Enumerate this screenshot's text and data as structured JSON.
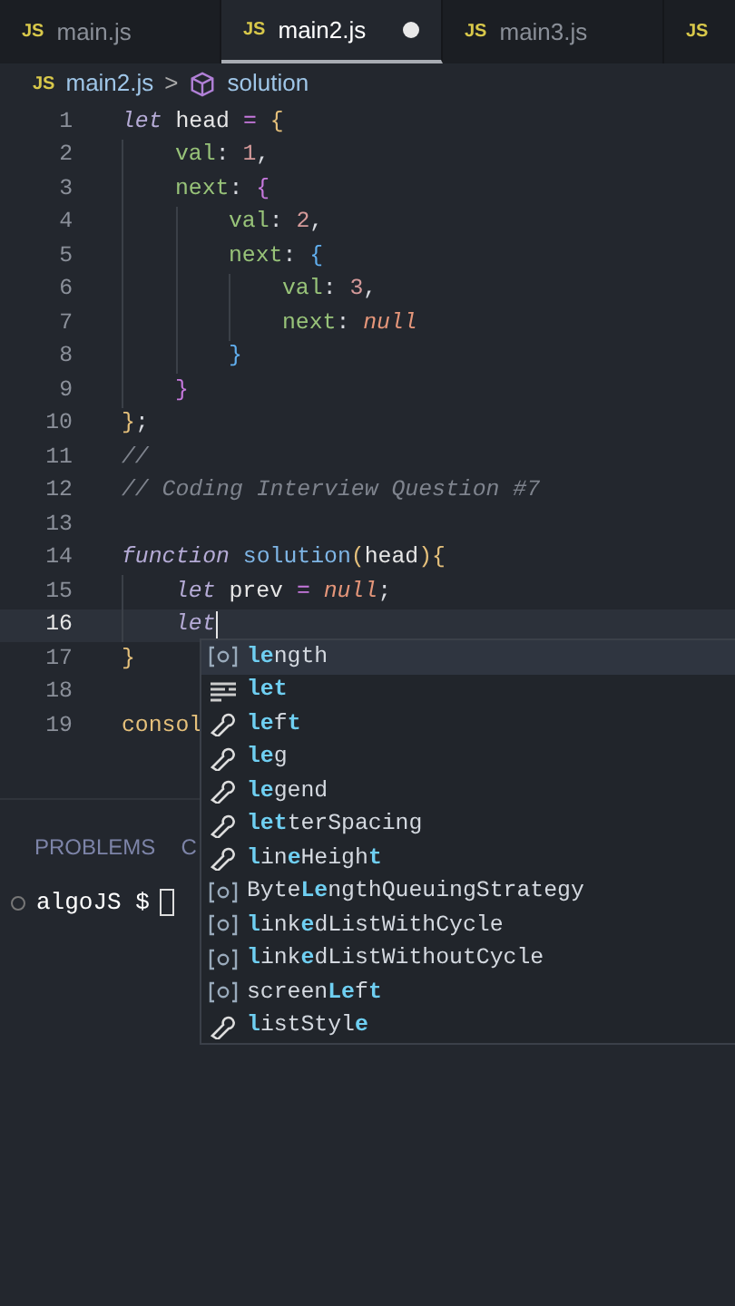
{
  "tabs": [
    {
      "icon": "JS",
      "label": "main.js",
      "selected": false,
      "modified": false
    },
    {
      "icon": "JS",
      "label": "main2.js",
      "selected": true,
      "modified": true
    },
    {
      "icon": "JS",
      "label": "main3.js",
      "selected": false,
      "modified": false
    },
    {
      "icon": "JS",
      "selected": false
    }
  ],
  "breadcrumb": {
    "icon": "JS",
    "file": "main2.js",
    "separator": ">",
    "symbol": "solution"
  },
  "code": [
    {
      "number": "1",
      "current": false,
      "tokens": [
        {
          "kind": "keyword",
          "text": "let"
        },
        {
          "kind": "plain",
          "text": " head "
        },
        {
          "kind": "op",
          "text": "= "
        },
        {
          "kind": "brace1",
          "text": "{"
        }
      ]
    },
    {
      "number": "2",
      "current": false,
      "tokens": [
        {
          "kind": "prop",
          "text": "    val"
        },
        {
          "kind": "punct",
          "text": ": "
        },
        {
          "kind": "number",
          "text": "1"
        },
        {
          "kind": "punct",
          "text": ","
        }
      ]
    },
    {
      "number": "3",
      "current": false,
      "tokens": [
        {
          "kind": "prop",
          "text": "    next"
        },
        {
          "kind": "punct",
          "text": ": "
        },
        {
          "kind": "brace2",
          "text": "{"
        }
      ]
    },
    {
      "number": "4",
      "current": false,
      "tokens": [
        {
          "kind": "prop",
          "text": "        val"
        },
        {
          "kind": "punct",
          "text": ": "
        },
        {
          "kind": "number",
          "text": "2"
        },
        {
          "kind": "punct",
          "text": ","
        }
      ]
    },
    {
      "number": "5",
      "current": false,
      "tokens": [
        {
          "kind": "prop",
          "text": "        next"
        },
        {
          "kind": "punct",
          "text": ": "
        },
        {
          "kind": "brace3",
          "text": "{"
        }
      ]
    },
    {
      "number": "6",
      "current": false,
      "tokens": [
        {
          "kind": "prop",
          "text": "            val"
        },
        {
          "kind": "punct",
          "text": ": "
        },
        {
          "kind": "number",
          "text": "3"
        },
        {
          "kind": "punct",
          "text": ","
        }
      ]
    },
    {
      "number": "7",
      "current": false,
      "tokens": [
        {
          "kind": "prop",
          "text": "            next"
        },
        {
          "kind": "punct",
          "text": ": "
        },
        {
          "kind": "null",
          "text": "null"
        }
      ]
    },
    {
      "number": "8",
      "current": false,
      "tokens": [
        {
          "kind": "brace3",
          "text": "        }"
        }
      ]
    },
    {
      "number": "9",
      "current": false,
      "tokens": [
        {
          "kind": "brace2",
          "text": "    }"
        }
      ]
    },
    {
      "number": "10",
      "current": false,
      "tokens": [
        {
          "kind": "brace1",
          "text": "}"
        },
        {
          "kind": "punct",
          "text": ";"
        }
      ]
    },
    {
      "number": "11",
      "current": false,
      "tokens": [
        {
          "kind": "comment",
          "text": "//"
        }
      ]
    },
    {
      "number": "12",
      "current": false,
      "tokens": [
        {
          "kind": "comment",
          "text": "// Coding Interview Question #7"
        }
      ]
    },
    {
      "number": "13",
      "current": false
    },
    {
      "number": "14",
      "current": false,
      "tokens": [
        {
          "kind": "keyword",
          "text": "function "
        },
        {
          "kind": "fn",
          "text": "solution"
        },
        {
          "kind": "brace1",
          "text": "("
        },
        {
          "kind": "plain",
          "text": "head"
        },
        {
          "kind": "brace1",
          "text": "){"
        }
      ]
    },
    {
      "number": "15",
      "current": false,
      "tokens": [
        {
          "kind": "keyword",
          "text": "    let"
        },
        {
          "kind": "plain",
          "text": " prev "
        },
        {
          "kind": "op",
          "text": "= "
        },
        {
          "kind": "null",
          "text": "null"
        },
        {
          "kind": "punct",
          "text": ";"
        }
      ]
    },
    {
      "number": "16",
      "current": true,
      "tokens": [
        {
          "kind": "keyword",
          "text": "    let"
        }
      ]
    },
    {
      "number": "17",
      "current": false,
      "tokens": [
        {
          "kind": "brace1",
          "text": "}"
        }
      ]
    },
    {
      "number": "18",
      "current": false
    },
    {
      "number": "19",
      "current": false,
      "tokens": [
        {
          "kind": "global",
          "text": "consol"
        }
      ]
    }
  ],
  "suggestions": [
    {
      "kind": "variable",
      "selected": true,
      "parts": [
        {
          "text": "le",
          "match": true
        },
        {
          "text": "ngth",
          "match": false
        }
      ]
    },
    {
      "kind": "keyword",
      "selected": false,
      "parts": [
        {
          "text": "let",
          "match": true
        }
      ]
    },
    {
      "kind": "property",
      "selected": false,
      "parts": [
        {
          "text": "le",
          "match": true
        },
        {
          "text": "f",
          "match": false
        },
        {
          "text": "t",
          "match": true
        }
      ]
    },
    {
      "kind": "property",
      "selected": false,
      "parts": [
        {
          "text": "le",
          "match": true
        },
        {
          "text": "g",
          "match": false
        }
      ]
    },
    {
      "kind": "property",
      "selected": false,
      "parts": [
        {
          "text": "le",
          "match": true
        },
        {
          "text": "gend",
          "match": false
        }
      ]
    },
    {
      "kind": "property",
      "selected": false,
      "parts": [
        {
          "text": "let",
          "match": true
        },
        {
          "text": "terSpacing",
          "match": false
        }
      ]
    },
    {
      "kind": "property",
      "selected": false,
      "parts": [
        {
          "text": "l",
          "match": true
        },
        {
          "text": "in",
          "match": false
        },
        {
          "text": "e",
          "match": true
        },
        {
          "text": "Heigh",
          "match": false
        },
        {
          "text": "t",
          "match": true
        }
      ]
    },
    {
      "kind": "variable",
      "selected": false,
      "parts": [
        {
          "text": "Byte",
          "match": false
        },
        {
          "text": "Le",
          "match": true
        },
        {
          "text": "ngthQueuingStrategy",
          "match": false
        }
      ]
    },
    {
      "kind": "variable",
      "selected": false,
      "parts": [
        {
          "text": "l",
          "match": true
        },
        {
          "text": "ink",
          "match": false
        },
        {
          "text": "e",
          "match": true
        },
        {
          "text": "dListWithCycle",
          "match": false
        }
      ]
    },
    {
      "kind": "variable",
      "selected": false,
      "parts": [
        {
          "text": "l",
          "match": true
        },
        {
          "text": "ink",
          "match": false
        },
        {
          "text": "e",
          "match": true
        },
        {
          "text": "dListWithoutCycle",
          "match": false
        }
      ]
    },
    {
      "kind": "variable",
      "selected": false,
      "parts": [
        {
          "text": "screen",
          "match": false
        },
        {
          "text": "Le",
          "match": true
        },
        {
          "text": "f",
          "match": false
        },
        {
          "text": "t",
          "match": true
        }
      ]
    },
    {
      "kind": "property",
      "selected": false,
      "parts": [
        {
          "text": "l",
          "match": true
        },
        {
          "text": "istStyl",
          "match": false
        },
        {
          "text": "e",
          "match": true
        }
      ]
    }
  ],
  "panel_tabs": [
    "PROBLEMS",
    "C"
  ],
  "terminal": {
    "prompt": "algoJS $"
  }
}
